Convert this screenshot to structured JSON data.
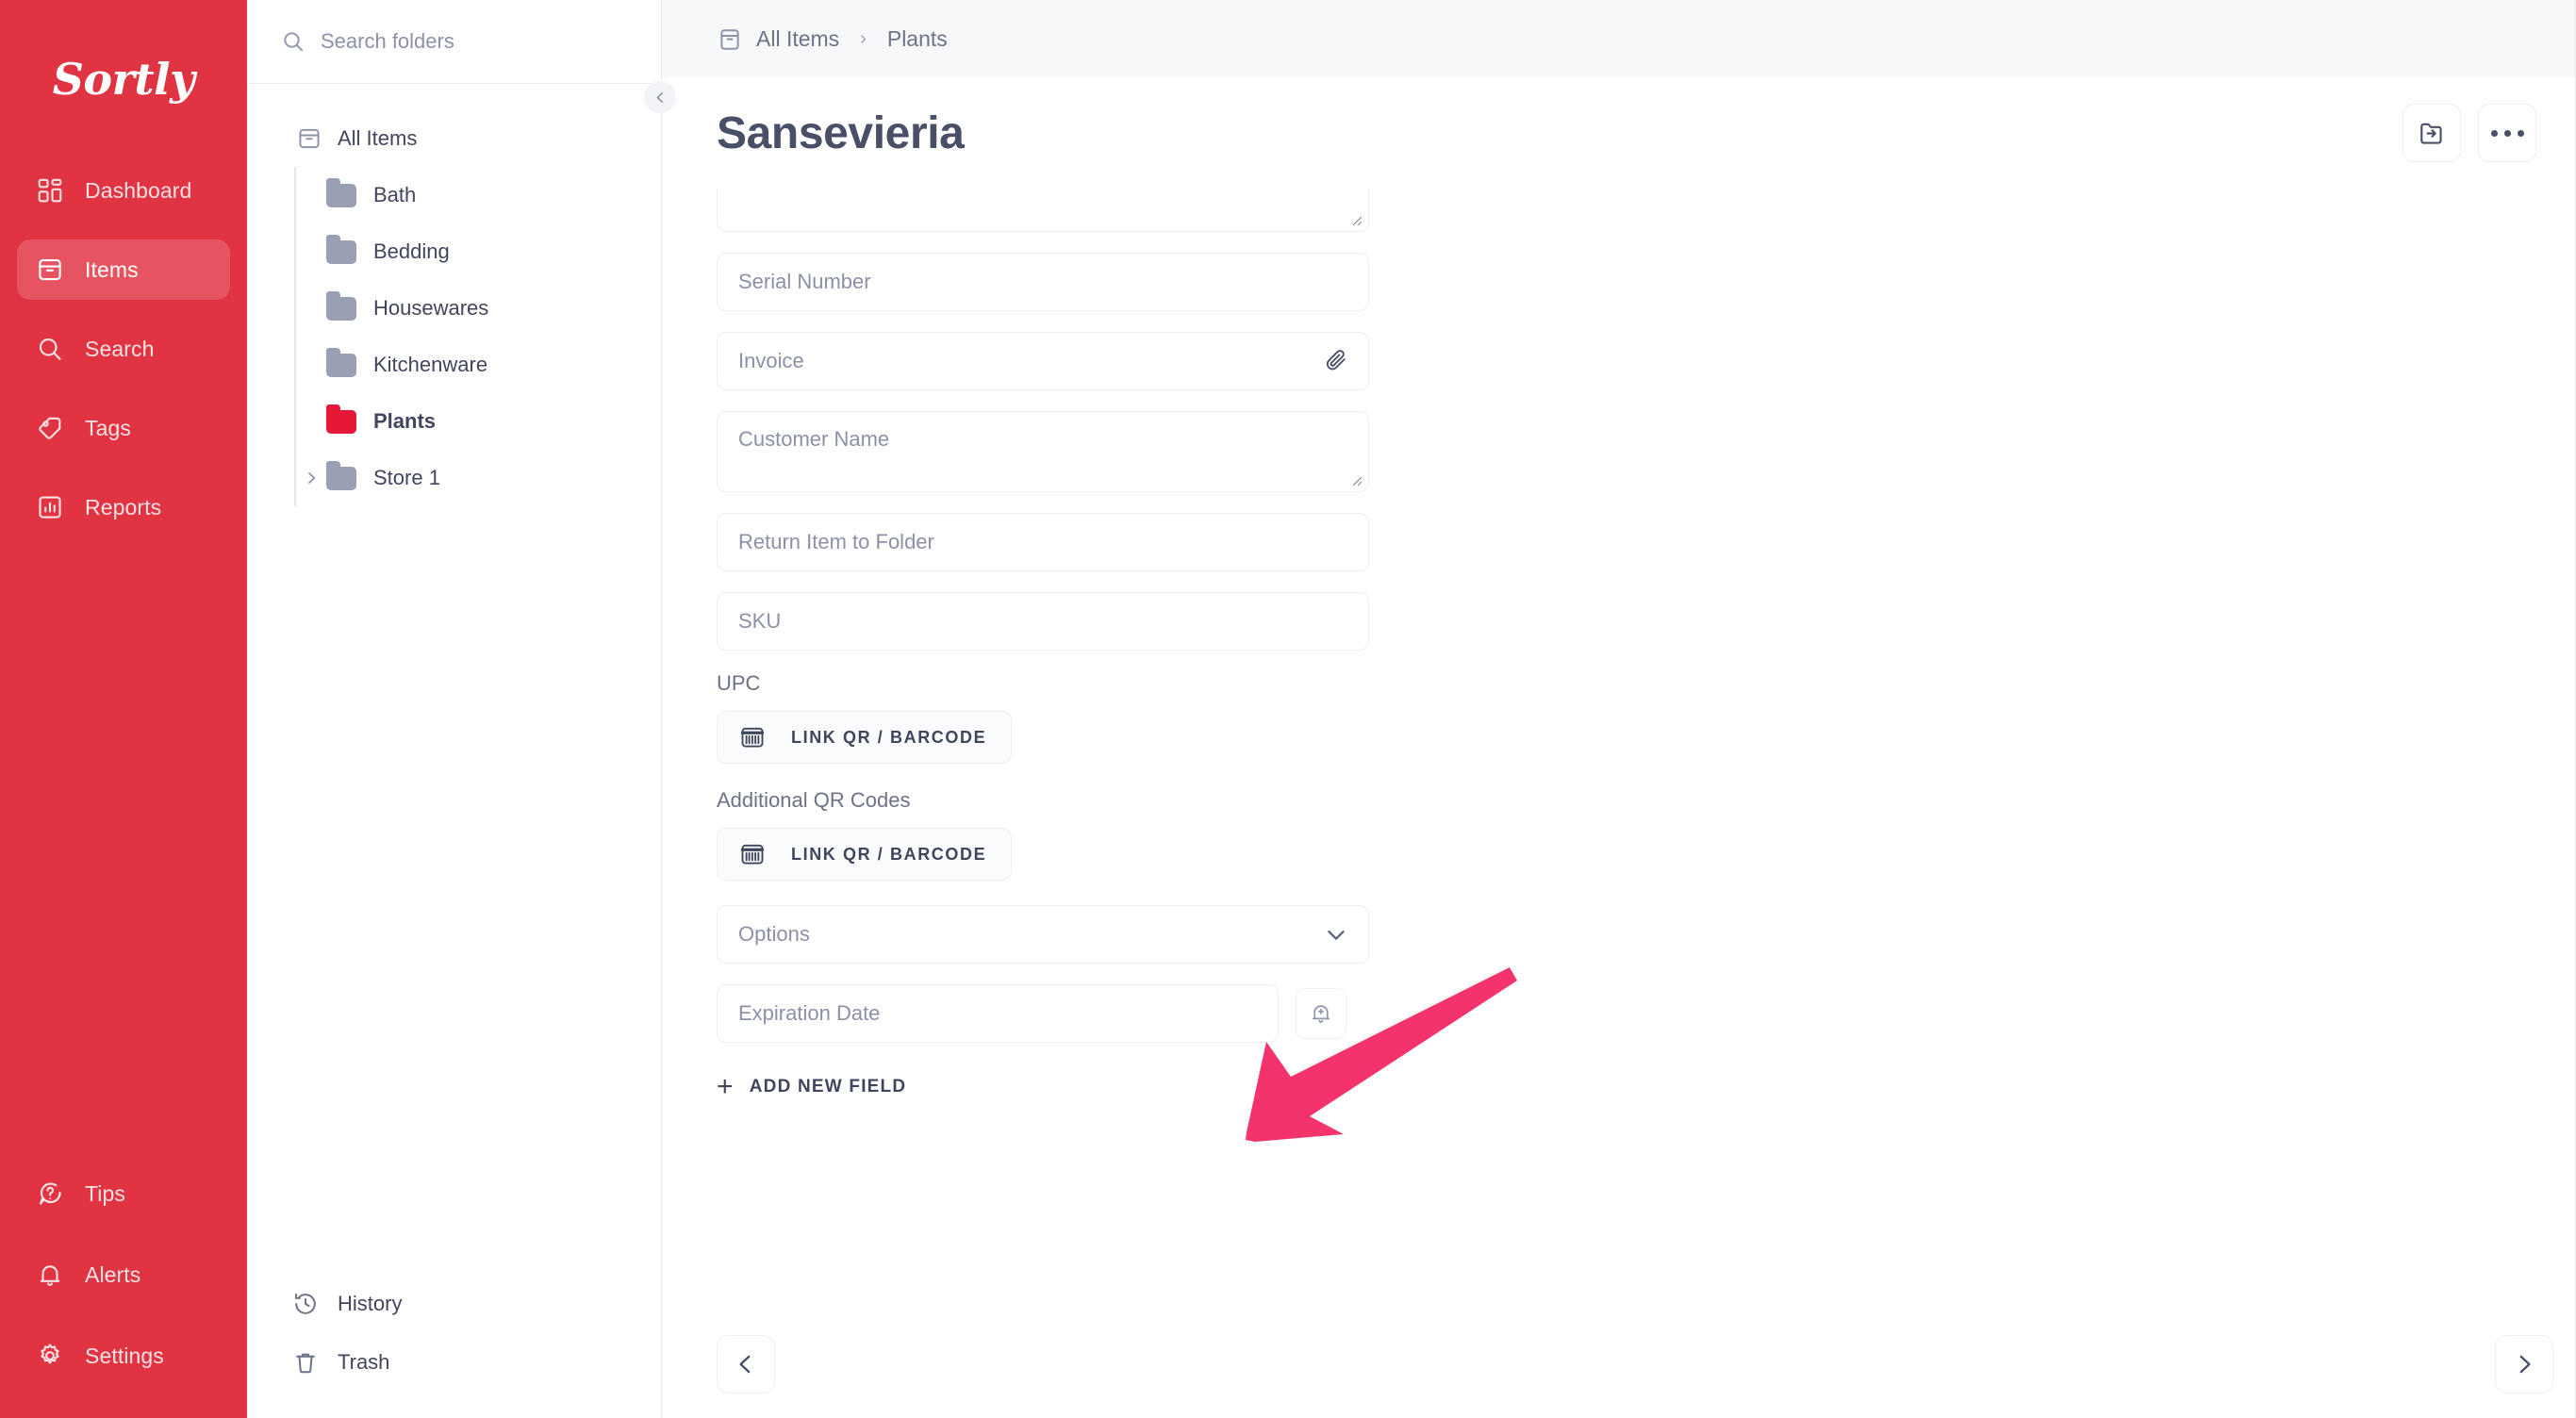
{
  "app": {
    "brand": "Sortly",
    "accent_red": "#e03442",
    "folder_red": "#e51937",
    "arrow_color": "#f4336d"
  },
  "rail": {
    "items": [
      {
        "label": "Dashboard",
        "icon": "dashboard-icon",
        "active": false
      },
      {
        "label": "Items",
        "icon": "box-icon",
        "active": true
      },
      {
        "label": "Search",
        "icon": "search-icon",
        "active": false
      },
      {
        "label": "Tags",
        "icon": "tag-icon",
        "active": false
      },
      {
        "label": "Reports",
        "icon": "reports-icon",
        "active": false
      }
    ],
    "bottom_items": [
      {
        "label": "Tips",
        "icon": "question-bubble-icon"
      },
      {
        "label": "Alerts",
        "icon": "bell-icon"
      },
      {
        "label": "Settings",
        "icon": "gear-icon"
      }
    ]
  },
  "folders": {
    "search_placeholder": "Search folders",
    "search_value": "",
    "root": {
      "label": "All Items",
      "icon": "box-icon"
    },
    "children": [
      {
        "label": "Bath",
        "color": "grey",
        "expandable": false,
        "selected": false
      },
      {
        "label": "Bedding",
        "color": "grey",
        "expandable": false,
        "selected": false
      },
      {
        "label": "Housewares",
        "color": "grey",
        "expandable": false,
        "selected": false
      },
      {
        "label": "Kitchenware",
        "color": "grey",
        "expandable": false,
        "selected": false
      },
      {
        "label": "Plants",
        "color": "red",
        "expandable": false,
        "selected": true
      },
      {
        "label": "Store 1",
        "color": "grey",
        "expandable": true,
        "selected": false
      }
    ],
    "bottom": [
      {
        "label": "History",
        "icon": "history-icon"
      },
      {
        "label": "Trash",
        "icon": "trash-icon"
      }
    ]
  },
  "header": {
    "breadcrumb": [
      "All Items",
      "Plants"
    ],
    "breadcrumb_sep": "›",
    "title": "Sansevieria",
    "actions": [
      {
        "name": "move-to-folder-button",
        "icon": "folder-arrow-icon"
      },
      {
        "name": "more-options-button",
        "icon": "ellipsis-icon"
      }
    ]
  },
  "form": {
    "fields": [
      {
        "type": "textarea-clipped",
        "placeholder": "",
        "name": "notes-field"
      },
      {
        "type": "input",
        "placeholder": "Serial Number",
        "name": "serial-number-field"
      },
      {
        "type": "input-icon",
        "placeholder": "Invoice",
        "icon": "paperclip-icon",
        "name": "invoice-field"
      },
      {
        "type": "textarea",
        "placeholder": "Customer Name",
        "name": "customer-name-field"
      },
      {
        "type": "input",
        "placeholder": "Return Item to Folder",
        "name": "return-item-to-folder-field"
      },
      {
        "type": "input",
        "placeholder": "SKU",
        "name": "sku-field"
      }
    ],
    "upc": {
      "label": "UPC",
      "button_label": "LINK QR / BARCODE",
      "icon": "barcode-icon"
    },
    "additional_qr": {
      "label": "Additional QR Codes",
      "button_label": "LINK QR / BARCODE",
      "icon": "barcode-icon"
    },
    "options": {
      "placeholder": "Options",
      "icon": "chevron-down-icon"
    },
    "expiration": {
      "placeholder": "Expiration Date",
      "icon": "calendar-icon",
      "alert_icon": "bell-plus-icon"
    },
    "add_new_field": {
      "label": "ADD NEW FIELD",
      "plus": "+"
    }
  },
  "pager": {
    "prev": {
      "name": "previous-item-button",
      "icon": "chevron-left-icon"
    },
    "next": {
      "name": "next-item-button",
      "icon": "chevron-right-icon"
    }
  },
  "collapse": {
    "icon": "chevron-left-icon"
  }
}
